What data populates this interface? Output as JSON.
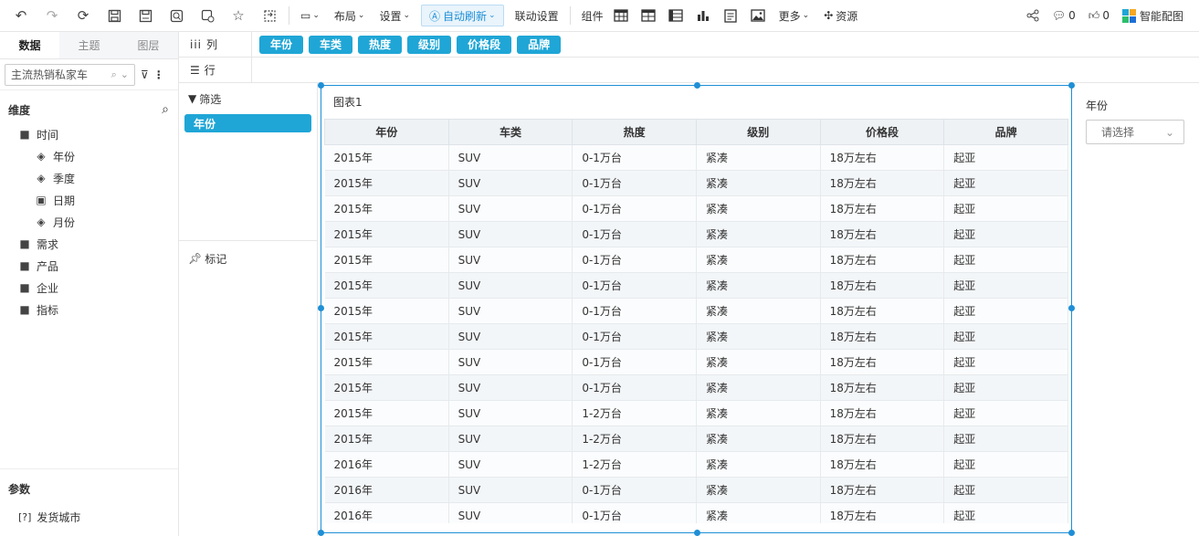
{
  "toolbar": {
    "layout": "布局",
    "settings": "设置",
    "auto_refresh": "自动刷新",
    "linkage": "联动设置",
    "component": "组件",
    "more": "更多",
    "resources": "资源",
    "comments_count": "0",
    "likes_count": "0",
    "smart_chart": "智能配图"
  },
  "left": {
    "tabs": [
      "数据",
      "主题",
      "图层"
    ],
    "dataset": "主流热销私家车",
    "dimensions_title": "维度",
    "tree": [
      {
        "label": "时间",
        "icon": "folder-open-icon"
      },
      {
        "label": "年份",
        "icon": "layers-icon"
      },
      {
        "label": "季度",
        "icon": "layers-icon"
      },
      {
        "label": "日期",
        "icon": "calendar-icon"
      },
      {
        "label": "月份",
        "icon": "layers-icon"
      },
      {
        "label": "需求",
        "icon": "folder-icon"
      },
      {
        "label": "产品",
        "icon": "folder-icon"
      },
      {
        "label": "企业",
        "icon": "folder-icon"
      },
      {
        "label": "指标",
        "icon": "folder-icon"
      }
    ],
    "params_title": "参数",
    "params": [
      {
        "label": "发货城市"
      }
    ]
  },
  "shelves": {
    "columns_label": "列",
    "rows_label": "行",
    "column_fields": [
      "年份",
      "车类",
      "热度",
      "级别",
      "价格段",
      "品牌"
    ]
  },
  "filter": {
    "title": "筛选",
    "field": "年份"
  },
  "marks": {
    "title": "标记"
  },
  "chart": {
    "title": "图表1",
    "columns": [
      "年份",
      "车类",
      "热度",
      "级别",
      "价格段",
      "品牌"
    ],
    "rows": [
      [
        "2015年",
        "SUV",
        "0-1万台",
        "紧凑",
        "18万左右",
        "起亚"
      ],
      [
        "2015年",
        "SUV",
        "0-1万台",
        "紧凑",
        "18万左右",
        "起亚"
      ],
      [
        "2015年",
        "SUV",
        "0-1万台",
        "紧凑",
        "18万左右",
        "起亚"
      ],
      [
        "2015年",
        "SUV",
        "0-1万台",
        "紧凑",
        "18万左右",
        "起亚"
      ],
      [
        "2015年",
        "SUV",
        "0-1万台",
        "紧凑",
        "18万左右",
        "起亚"
      ],
      [
        "2015年",
        "SUV",
        "0-1万台",
        "紧凑",
        "18万左右",
        "起亚"
      ],
      [
        "2015年",
        "SUV",
        "0-1万台",
        "紧凑",
        "18万左右",
        "起亚"
      ],
      [
        "2015年",
        "SUV",
        "0-1万台",
        "紧凑",
        "18万左右",
        "起亚"
      ],
      [
        "2015年",
        "SUV",
        "0-1万台",
        "紧凑",
        "18万左右",
        "起亚"
      ],
      [
        "2015年",
        "SUV",
        "0-1万台",
        "紧凑",
        "18万左右",
        "起亚"
      ],
      [
        "2015年",
        "SUV",
        "1-2万台",
        "紧凑",
        "18万左右",
        "起亚"
      ],
      [
        "2015年",
        "SUV",
        "1-2万台",
        "紧凑",
        "18万左右",
        "起亚"
      ],
      [
        "2016年",
        "SUV",
        "1-2万台",
        "紧凑",
        "18万左右",
        "起亚"
      ],
      [
        "2016年",
        "SUV",
        "0-1万台",
        "紧凑",
        "18万左右",
        "起亚"
      ],
      [
        "2016年",
        "SUV",
        "0-1万台",
        "紧凑",
        "18万左右",
        "起亚"
      ]
    ]
  },
  "right": {
    "label": "年份",
    "select_placeholder": "请选择"
  },
  "colors": {
    "accent": "#1fa6d6",
    "selection": "#1e8fd6"
  }
}
